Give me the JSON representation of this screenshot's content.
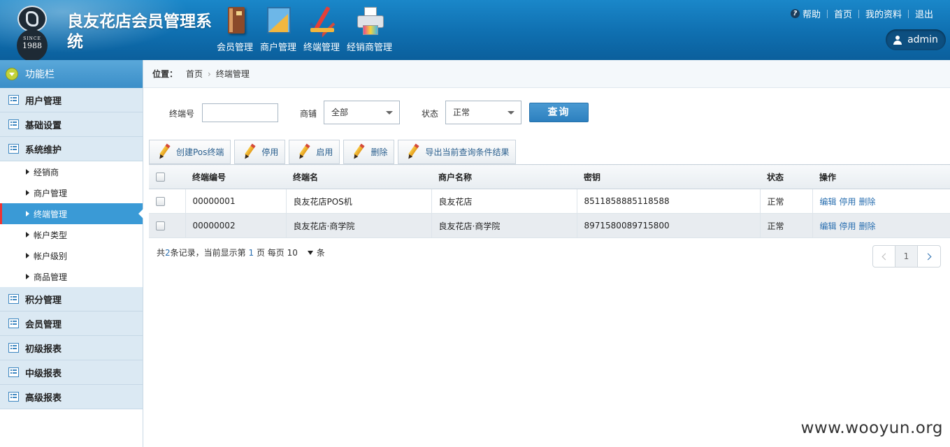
{
  "header": {
    "logo_since": "SINCE",
    "logo_year": "1988",
    "title": "良友花店会员管理系统",
    "nav": [
      {
        "label": "会员管理",
        "icon": "book-icon"
      },
      {
        "label": "商户管理",
        "icon": "ruler-icon"
      },
      {
        "label": "终端管理",
        "icon": "tools-icon"
      },
      {
        "label": "经销商管理",
        "icon": "printer-icon"
      }
    ],
    "links": {
      "help": "帮助",
      "home": "首页",
      "profile": "我的资料",
      "logout": "退出"
    },
    "user": "admin"
  },
  "sidebar": {
    "header": "功能栏",
    "groups_top": [
      "用户管理",
      "基础设置",
      "系统维护"
    ],
    "sub_items": [
      "经销商",
      "商户管理",
      "终端管理",
      "帐户类型",
      "帐户级别",
      "商品管理"
    ],
    "active_sub": "终端管理",
    "groups_bottom": [
      "积分管理",
      "会员管理",
      "初级报表",
      "中级报表",
      "高级报表"
    ]
  },
  "breadcrumb": {
    "label": "位置：",
    "home": "首页",
    "current": "终端管理"
  },
  "filters": {
    "terminal_no_label": "终端号",
    "terminal_no_value": "",
    "shop_label": "商铺",
    "shop_value": "全部",
    "status_label": "状态",
    "status_value": "正常",
    "query_button": "查询"
  },
  "toolbar": {
    "create": "创建Pos终端",
    "disable": "停用",
    "enable": "启用",
    "delete": "删除",
    "export": "导出当前查询条件结果"
  },
  "table": {
    "columns": [
      "终端编号",
      "终端名",
      "商户名称",
      "密钥",
      "状态",
      "操作"
    ],
    "rows": [
      {
        "id": "00000001",
        "name": "良友花店POS机",
        "merchant": "良友花店",
        "key": "8511858885118588",
        "status": "正常"
      },
      {
        "id": "00000002",
        "name": "良友花店·商学院",
        "merchant": "良友花店·商学院",
        "key": "8971580089715800",
        "status": "正常"
      }
    ],
    "actions": {
      "edit": "编辑",
      "disable": "停用",
      "delete": "删除"
    }
  },
  "pager": {
    "text_prefix": "共",
    "total": "2",
    "text_mid": "条记录，当前显示第",
    "page": "1",
    "text_per": "页 每页",
    "per_page": "10",
    "text_suffix": "条",
    "current": "1"
  },
  "watermark": "www.wooyun.org",
  "colors": {
    "header": "#1a87c9",
    "accent": "#3a9ad6",
    "link": "#2a6fb0"
  }
}
